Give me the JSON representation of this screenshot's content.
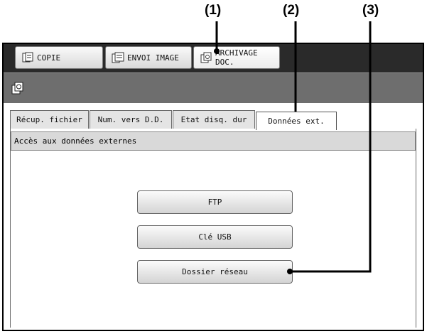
{
  "callouts": {
    "c1": "(1)",
    "c2": "(2)",
    "c3": "(3)"
  },
  "modes": {
    "copie": "COPIE",
    "envoi": "ENVOI IMAGE",
    "archivage_line1": "ARCHIVAGE",
    "archivage_line2": "DOC."
  },
  "tabs": {
    "recup": "Récup. fichier",
    "num": "Num. vers D.D.",
    "etat": "Etat disq. dur",
    "donnees": "Données ext."
  },
  "panel": {
    "header": "Accès aux données externes",
    "options": {
      "ftp": "FTP",
      "usb": "Clé USB",
      "network": "Dossier réseau"
    }
  },
  "icons": {
    "copie": "copier-icon",
    "envoi": "scan-send-icon",
    "archivage": "document-filing-icon",
    "iconbar": "document-filing-icon"
  }
}
